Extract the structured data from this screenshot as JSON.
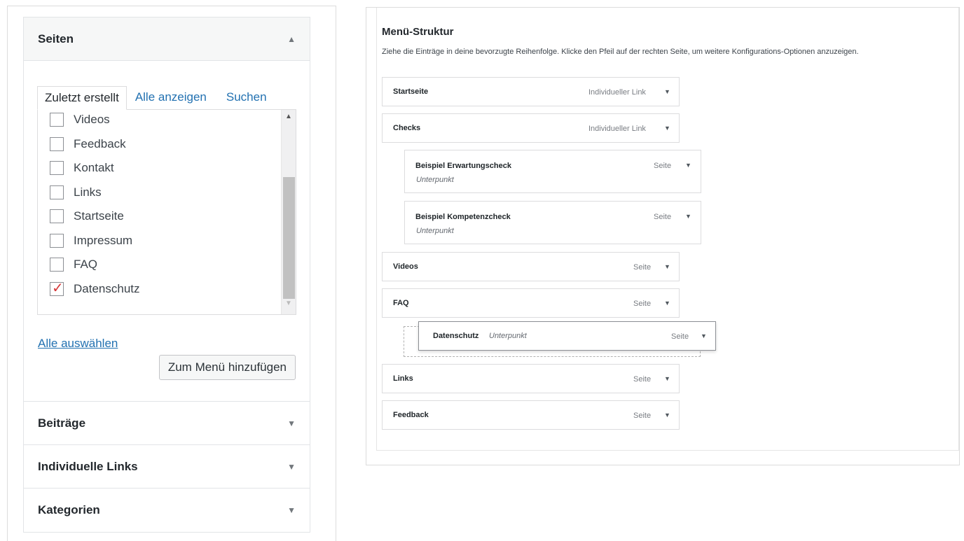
{
  "left_panel": {
    "sections": [
      {
        "title": "Seiten",
        "state": "open"
      },
      {
        "title": "Beiträge",
        "state": "closed"
      },
      {
        "title": "Individuelle Links",
        "state": "closed"
      },
      {
        "title": "Kategorien",
        "state": "closed"
      }
    ],
    "tabs": [
      {
        "label": "Zuletzt erstellt",
        "active": true
      },
      {
        "label": "Alle anzeigen",
        "active": false
      },
      {
        "label": "Suchen",
        "active": false
      }
    ],
    "pages": [
      {
        "label": "Videos",
        "checked": false
      },
      {
        "label": "Feedback",
        "checked": false
      },
      {
        "label": "Kontakt",
        "checked": false
      },
      {
        "label": "Links",
        "checked": false
      },
      {
        "label": "Startseite",
        "checked": false
      },
      {
        "label": "Impressum",
        "checked": false
      },
      {
        "label": "FAQ",
        "checked": false
      },
      {
        "label": "Datenschutz",
        "checked": true
      }
    ],
    "select_all": "Alle auswählen",
    "add_button": "Zum Menü hinzufügen",
    "arrow_up": "▲",
    "arrow_down": "▼",
    "checkmark": "✓"
  },
  "menu_structure": {
    "title": "Menü-Struktur",
    "description": "Ziehe die Einträge in deine bevorzugte Reihenfolge. Klicke den Pfeil auf der rechten Seite, um weitere Konfigurations-Optionen anzuzeigen.",
    "items": [
      {
        "title": "Startseite",
        "type": "Individueller Link",
        "depth": 0,
        "subtitle": ""
      },
      {
        "title": "Checks",
        "type": "Individueller Link",
        "depth": 0,
        "subtitle": ""
      },
      {
        "title": "Beispiel Erwartungscheck",
        "type": "Seite",
        "depth": 1,
        "subtitle": "Unterpunkt"
      },
      {
        "title": "Beispiel Kompetenzcheck",
        "type": "Seite",
        "depth": 1,
        "subtitle": "Unterpunkt"
      },
      {
        "title": "Videos",
        "type": "Seite",
        "depth": 0,
        "subtitle": ""
      },
      {
        "title": "FAQ",
        "type": "Seite",
        "depth": 0,
        "subtitle": ""
      },
      {
        "title": "Links",
        "type": "Seite",
        "depth": 0,
        "subtitle": ""
      },
      {
        "title": "Feedback",
        "type": "Seite",
        "depth": 0,
        "subtitle": ""
      }
    ],
    "dragging_item": {
      "title": "Datenschutz",
      "subtitle": "Unterpunkt",
      "type": "Seite"
    }
  }
}
